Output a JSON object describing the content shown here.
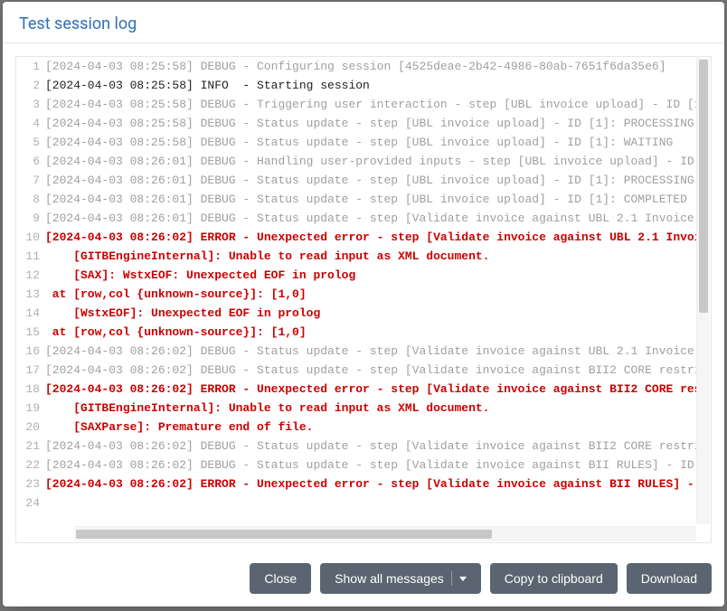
{
  "modal": {
    "title": "Test session log"
  },
  "buttons": {
    "close": "Close",
    "show_all": "Show all messages",
    "copy": "Copy to clipboard",
    "download": "Download"
  },
  "log_lines": [
    {
      "n": 1,
      "level": "debug",
      "text": "[2024-04-03 08:25:58] DEBUG - Configuring session [4525deae-2b42-4986-80ab-7651f6da35e6]"
    },
    {
      "n": 2,
      "level": "info",
      "text": "[2024-04-03 08:25:58] INFO  - Starting session"
    },
    {
      "n": 3,
      "level": "debug",
      "text": "[2024-04-03 08:25:58] DEBUG - Triggering user interaction - step [UBL invoice upload] - ID [1"
    },
    {
      "n": 4,
      "level": "debug",
      "text": "[2024-04-03 08:25:58] DEBUG - Status update - step [UBL invoice upload] - ID [1]: PROCESSING"
    },
    {
      "n": 5,
      "level": "debug",
      "text": "[2024-04-03 08:25:58] DEBUG - Status update - step [UBL invoice upload] - ID [1]: WAITING"
    },
    {
      "n": 6,
      "level": "debug",
      "text": "[2024-04-03 08:26:01] DEBUG - Handling user-provided inputs - step [UBL invoice upload] - ID "
    },
    {
      "n": 7,
      "level": "debug",
      "text": "[2024-04-03 08:26:01] DEBUG - Status update - step [UBL invoice upload] - ID [1]: PROCESSING"
    },
    {
      "n": 8,
      "level": "debug",
      "text": "[2024-04-03 08:26:01] DEBUG - Status update - step [UBL invoice upload] - ID [1]: COMPLETED"
    },
    {
      "n": 9,
      "level": "debug",
      "text": "[2024-04-03 08:26:01] DEBUG - Status update - step [Validate invoice against UBL 2.1 Invoice "
    },
    {
      "n": 10,
      "level": "error",
      "text": "[2024-04-03 08:26:02] ERROR - Unexpected error - step [Validate invoice against UBL 2.1 Invoi"
    },
    {
      "n": 11,
      "level": "error",
      "text": "    [GITBEngineInternal]: Unable to read input as XML document."
    },
    {
      "n": 12,
      "level": "error",
      "text": "    [SAX]: WstxEOF: Unexpected EOF in prolog"
    },
    {
      "n": 13,
      "level": "error",
      "text": " at [row,col {unknown-source}]: [1,0]"
    },
    {
      "n": 14,
      "level": "error",
      "text": "    [WstxEOF]: Unexpected EOF in prolog"
    },
    {
      "n": 15,
      "level": "error",
      "text": " at [row,col {unknown-source}]: [1,0]"
    },
    {
      "n": 16,
      "level": "debug",
      "text": "[2024-04-03 08:26:02] DEBUG - Status update - step [Validate invoice against UBL 2.1 Invoice "
    },
    {
      "n": 17,
      "level": "debug",
      "text": "[2024-04-03 08:26:02] DEBUG - Status update - step [Validate invoice against BII2 CORE restri"
    },
    {
      "n": 18,
      "level": "error",
      "text": "[2024-04-03 08:26:02] ERROR - Unexpected error - step [Validate invoice against BII2 CORE res"
    },
    {
      "n": 19,
      "level": "error",
      "text": "    [GITBEngineInternal]: Unable to read input as XML document."
    },
    {
      "n": 20,
      "level": "error",
      "text": "    [SAXParse]: Premature end of file."
    },
    {
      "n": 21,
      "level": "debug",
      "text": "[2024-04-03 08:26:02] DEBUG - Status update - step [Validate invoice against BII2 CORE restri"
    },
    {
      "n": 22,
      "level": "debug",
      "text": "[2024-04-03 08:26:02] DEBUG - Status update - step [Validate invoice against BII RULES] - ID "
    },
    {
      "n": 23,
      "level": "error",
      "text": "[2024-04-03 08:26:02] ERROR - Unexpected error - step [Validate invoice against BII RULES] - "
    },
    {
      "n": 24,
      "level": "partial",
      "text": " "
    }
  ]
}
